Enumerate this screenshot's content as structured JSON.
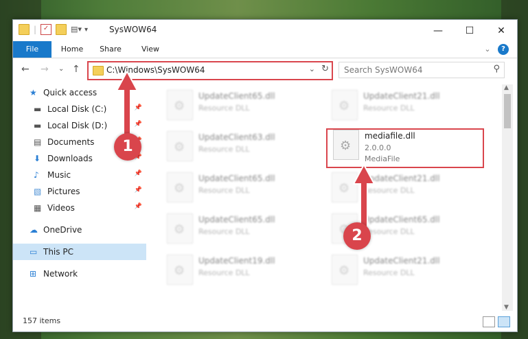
{
  "window": {
    "title": "SysWOW64",
    "minimize": "—",
    "maximize": "☐",
    "close": "✕"
  },
  "ribbon": {
    "tabs": [
      "File",
      "Home",
      "Share",
      "View"
    ],
    "expand": "⌄",
    "help": "?"
  },
  "address": {
    "path": "C:\\Windows\\SysWOW64",
    "dropdown": "⌄",
    "refresh": "↻"
  },
  "search": {
    "placeholder": "Search SysWOW64",
    "icon": "search-icon"
  },
  "nav": {
    "back": "←",
    "forward": "→",
    "recent": "⌄",
    "up": "↑"
  },
  "navpane": {
    "items": [
      {
        "label": "Quick access",
        "icon": "star-icon",
        "pinned": false
      },
      {
        "label": "Local Disk (C:)",
        "icon": "drive-icon",
        "pinned": true
      },
      {
        "label": "Local Disk (D:)",
        "icon": "drive-icon",
        "pinned": true
      },
      {
        "label": "Documents",
        "icon": "document-icon",
        "pinned": true
      },
      {
        "label": "Downloads",
        "icon": "download-icon",
        "pinned": true
      },
      {
        "label": "Music",
        "icon": "music-icon",
        "pinned": true
      },
      {
        "label": "Pictures",
        "icon": "picture-icon",
        "pinned": true
      },
      {
        "label": "Videos",
        "icon": "video-icon",
        "pinned": true
      },
      {
        "label": "OneDrive",
        "icon": "cloud-icon",
        "pinned": false
      },
      {
        "label": "This PC",
        "icon": "computer-icon",
        "pinned": false,
        "selected": true
      },
      {
        "label": "Network",
        "icon": "network-icon",
        "pinned": false
      }
    ]
  },
  "files": [
    {
      "name": "UpdateClient65.dll",
      "sub": "Resource DLL"
    },
    {
      "name": "UpdateClient21.dll",
      "sub": "Resource DLL"
    },
    {
      "name": "UpdateClient63.dll",
      "sub": "Resource DLL"
    },
    {
      "name": "mediafile.dll",
      "sub": "2.0.0.0",
      "sub2": "MediaFile",
      "highlighted": true
    },
    {
      "name": "UpdateClient65.dll",
      "sub": "Resource DLL"
    },
    {
      "name": "UpdateClient21.dll",
      "sub": "Resource DLL"
    },
    {
      "name": "UpdateClient65.dll",
      "sub": "Resource DLL"
    },
    {
      "name": "UpdateClient65.dll",
      "sub": "Resource DLL"
    },
    {
      "name": "UpdateClient19.dll",
      "sub": "Resource DLL"
    },
    {
      "name": "UpdateClient21.dll",
      "sub": "Resource DLL"
    }
  ],
  "status": {
    "count": "157 items"
  },
  "annotations": {
    "badge1": "1",
    "badge2": "2"
  },
  "colors": {
    "accent": "#1979ca",
    "highlight": "#d9454c"
  }
}
